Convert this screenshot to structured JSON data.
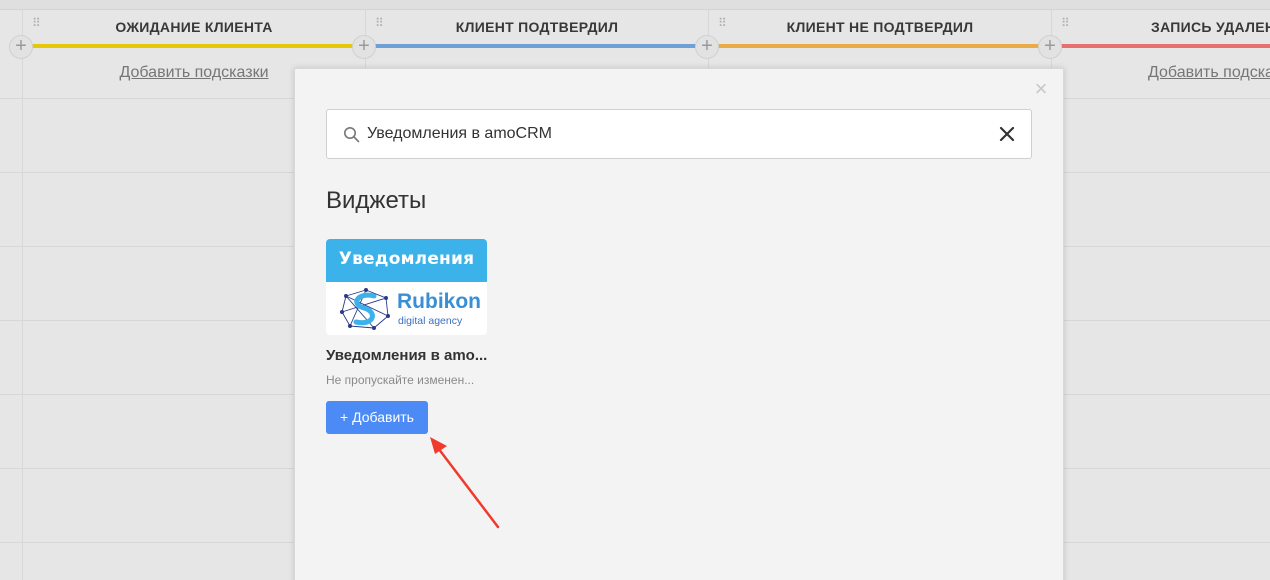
{
  "pipeline": {
    "columns": [
      {
        "title": "ОЖИДАНИЕ КЛИЕНТА",
        "color": "#f0d000",
        "hint": "Добавить подсказки"
      },
      {
        "title": "КЛИЕНТ ПОДТВЕРДИЛ",
        "color": "#6fa3e0",
        "hint": ""
      },
      {
        "title": "КЛИЕНТ НЕ ПОДТВЕРДИЛ",
        "color": "#f2b042",
        "hint": ""
      },
      {
        "title": "ЗАПИСЬ УДАЛЕН",
        "color": "#f07070",
        "hint": "Добавить подска"
      }
    ]
  },
  "modal": {
    "search": {
      "value": "Уведомления в amoCRM",
      "icon": "search-icon",
      "clear_icon": "close-icon"
    },
    "close_icon": "close-icon",
    "section_title": "Виджеты",
    "widgets": [
      {
        "thumb_banner": "Уведомления",
        "logo_word": "Rubikon",
        "logo_sub": "digital agency",
        "name": "Уведомления в amo...",
        "description": "Не пропускайте изменен...",
        "add_label": "+ Добавить",
        "button_color": "#4c8bf5"
      }
    ]
  },
  "annotation": {
    "arrow_color": "#f03a2e"
  }
}
